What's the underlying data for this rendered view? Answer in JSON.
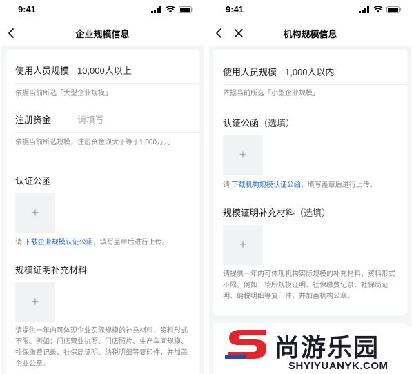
{
  "left_screen": {
    "status_time": "9:41",
    "nav_title": "企业规模信息",
    "staff_label": "使用人员规模",
    "staff_value": "10,000人以上",
    "staff_hint": "依据当前所选「大型企业规模」",
    "capital_label": "注册资金",
    "capital_placeholder": "请填写",
    "capital_hint": "依据当前所选规模，注册资金须大于等于1,000万元",
    "cert_title": "认证公函",
    "cert_hint_prefix": "请 ",
    "cert_hint_link": "下载企业规模认证公函",
    "cert_hint_suffix": "，填写盖章后进行上传。",
    "supp_title": "规模证明补充材料",
    "supp_hint": "请提供一年内可体现企业实际规模的补充材料，资料形式不限。例如：门店营业执照、门店照片、生产车间规模、社保缴费记录、社保局证明、纳税明细等复印件，并加盖企业公章。"
  },
  "right_screen": {
    "status_time": "9:41",
    "nav_title": "机构规模信息",
    "staff_label": "使用人员规模",
    "staff_value": "1,000人以内",
    "staff_hint": "依据当前所选「小型企业规模」",
    "cert_title": "认证公函",
    "cert_optional": "（选填）",
    "cert_hint_prefix": "请 ",
    "cert_hint_link": "下载机构规模认证公函",
    "cert_hint_suffix": "，填写盖章后进行上传。",
    "supp_title": "规模证明补充材料",
    "supp_optional": "（选填）",
    "supp_hint": "请提供一年内可体现机构实际规模的补充材料，资料形式不限。例如：场所规模证明、社保缴费记录、社保局证明、纳税明细等复印件，并加盖机构公章。"
  },
  "upload_symbol": "+",
  "watermark": {
    "brand_cn": "尚游乐园",
    "brand_en": "SHYIYUANYK.COM"
  },
  "colors": {
    "link": "#2a6fd6",
    "page_bg": "#f4f5f7",
    "watermark_red": "#e0252b",
    "watermark_blue": "#1f4fa8"
  },
  "icons": [
    "back-arrow-icon",
    "close-icon",
    "signal-icon",
    "wifi-icon",
    "battery-icon",
    "plus-icon"
  ]
}
